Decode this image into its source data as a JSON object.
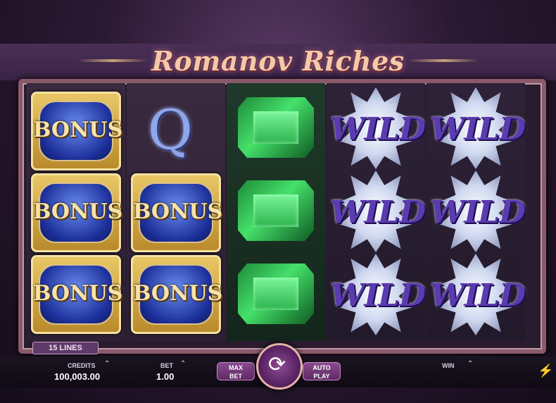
{
  "game": {
    "title": "Romanov Riches"
  },
  "reels": {
    "bonus_label": "BONUS",
    "queen_label": "Q",
    "wild_label": "WILD",
    "grid": [
      [
        "BONUS",
        "BONUS",
        "BONUS"
      ],
      [
        "Q",
        "BONUS",
        "BONUS"
      ],
      [
        "emerald",
        "emerald",
        "emerald"
      ],
      [
        "WILD",
        "WILD",
        "WILD"
      ],
      [
        "WILD",
        "WILD",
        "WILD"
      ]
    ]
  },
  "status": {
    "lines_label": "15 LINES"
  },
  "controls": {
    "credits_label": "CREDITS",
    "credits_value": "100,003.00",
    "bet_label": "BET",
    "bet_value": "1.00",
    "max_bet_line1": "MAX",
    "max_bet_line2": "BET",
    "auto_play_line1": "AUTO",
    "auto_play_line2": "PLAY",
    "win_label": "WIN"
  },
  "icons": {
    "spin": "spin-icon",
    "caret": "caret-up-icon",
    "turbo": "lightning-icon"
  },
  "colors": {
    "accent": "#8e4c90",
    "gold": "#e9c766",
    "emerald": "#45e06a",
    "wild_text": "#5b3bb0"
  }
}
